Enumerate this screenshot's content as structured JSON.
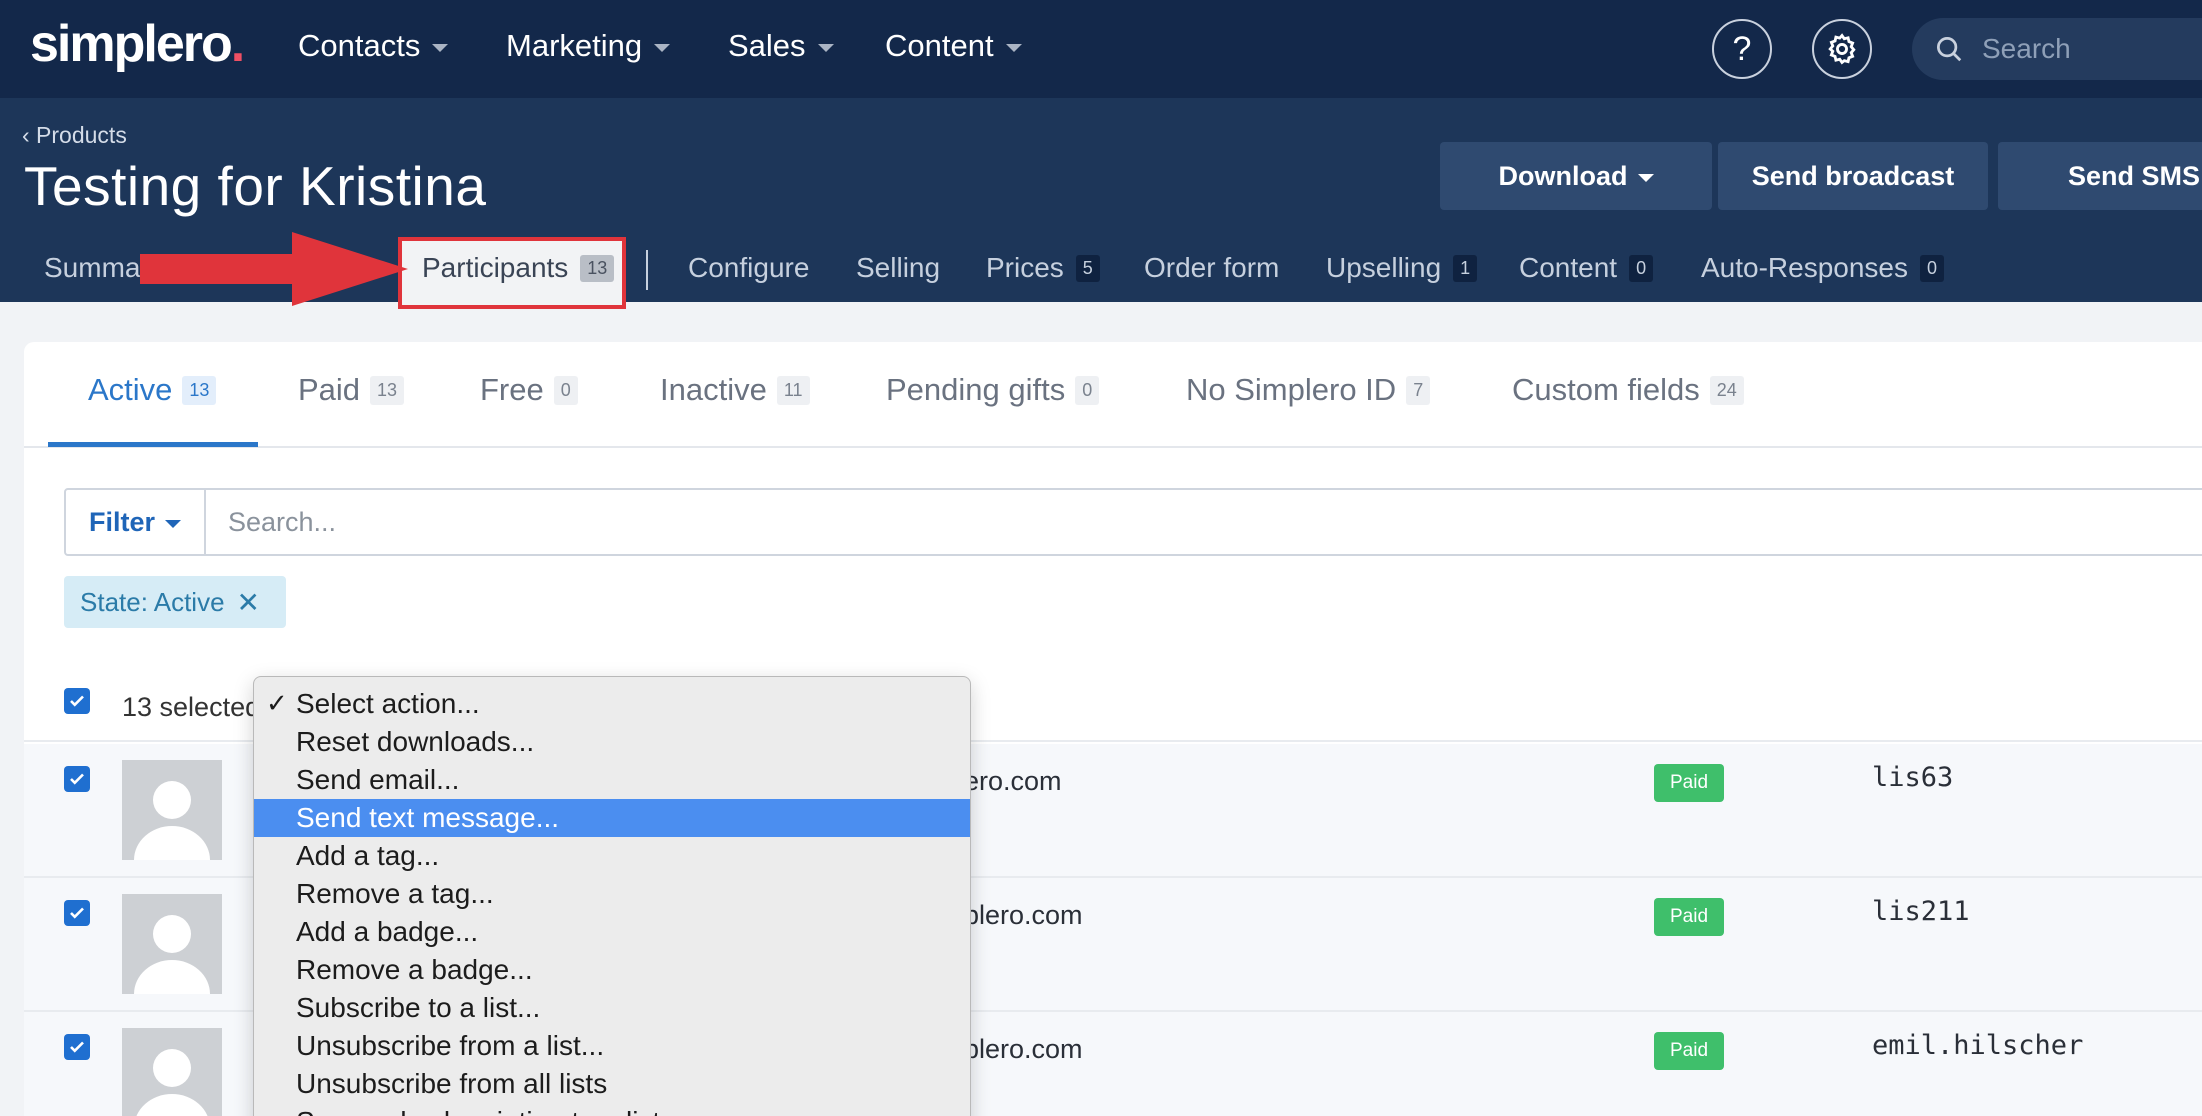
{
  "topnav": {
    "logo_text": "simplero",
    "logo_dot": ".",
    "items": [
      {
        "label": "Contacts"
      },
      {
        "label": "Marketing"
      },
      {
        "label": "Sales"
      },
      {
        "label": "Content"
      }
    ],
    "help_label": "?",
    "search_placeholder": "Search"
  },
  "header": {
    "breadcrumb": "‹ Products",
    "title": "Testing for Kristina",
    "buttons": {
      "download": "Download",
      "send_broadcast": "Send broadcast",
      "send_sms": "Send SMS"
    }
  },
  "tabs": [
    {
      "label": "Summary",
      "count": ""
    },
    {
      "label": "Participants",
      "count": "13"
    },
    {
      "label": "Configure",
      "count": ""
    },
    {
      "label": "Selling",
      "count": ""
    },
    {
      "label": "Prices",
      "count": "5"
    },
    {
      "label": "Order form",
      "count": ""
    },
    {
      "label": "Upselling",
      "count": "1"
    },
    {
      "label": "Content",
      "count": "0"
    },
    {
      "label": "Auto-Responses",
      "count": "0"
    }
  ],
  "subtabs": [
    {
      "label": "Active",
      "count": "13"
    },
    {
      "label": "Paid",
      "count": "13"
    },
    {
      "label": "Free",
      "count": "0"
    },
    {
      "label": "Inactive",
      "count": "11"
    },
    {
      "label": "Pending gifts",
      "count": "0"
    },
    {
      "label": "No Simplero ID",
      "count": "7"
    },
    {
      "label": "Custom fields",
      "count": "24"
    }
  ],
  "filter": {
    "button_label": "Filter",
    "search_placeholder": "Search...",
    "chip_label": "State: Active",
    "chip_close": "✕"
  },
  "selection": {
    "text": "13 selected"
  },
  "rows": [
    {
      "email_fragment": "ero.com",
      "status": "Paid",
      "username": "lis63"
    },
    {
      "email_fragment": "plero.com",
      "status": "Paid",
      "username": "lis211"
    },
    {
      "email_fragment": "plero.com",
      "status": "Paid",
      "username": "emil.hilscher"
    }
  ],
  "dropdown": {
    "options": [
      {
        "label": "Select action...",
        "checked": true
      },
      {
        "label": "Reset downloads..."
      },
      {
        "label": "Send email..."
      },
      {
        "label": "Send text message...",
        "highlighted": true
      },
      {
        "label": "Add a tag..."
      },
      {
        "label": "Remove a tag..."
      },
      {
        "label": "Add a badge..."
      },
      {
        "label": "Remove a badge..."
      },
      {
        "label": "Subscribe to a list..."
      },
      {
        "label": "Unsubscribe from a list..."
      },
      {
        "label": "Unsubscribe from all lists"
      },
      {
        "label": "Suspend subscription to a list..."
      }
    ],
    "check_glyph": "✓"
  },
  "colors": {
    "topbar": "#13284a",
    "header": "#1d3659",
    "accent": "#2b77c9",
    "paid_badge": "#3fbf6b",
    "highlight": "#4b8ef0",
    "annotation": "#e0343b"
  }
}
